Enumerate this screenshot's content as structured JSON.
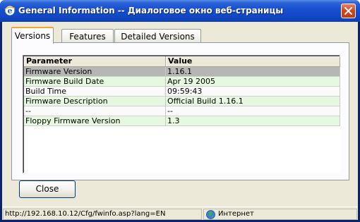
{
  "window": {
    "title": "General Information -- Диалоговое окно веб-страницы"
  },
  "tabs": [
    {
      "label": "Versions",
      "active": true
    },
    {
      "label": "Features",
      "active": false
    },
    {
      "label": "Detailed Versions",
      "active": false
    }
  ],
  "table": {
    "columns": [
      "Parameter",
      "Value"
    ],
    "rows": [
      {
        "parameter": "Firmware Version",
        "value": "1.16.1"
      },
      {
        "parameter": "Firmware Build Date",
        "value": "Apr 19 2005"
      },
      {
        "parameter": "Build Time",
        "value": "09:59:43"
      },
      {
        "parameter": "Firmware Description",
        "value": "Official Build 1.16.1"
      },
      {
        "parameter": "--",
        "value": "--"
      },
      {
        "parameter": "Floppy Firmware Version",
        "value": "1.3"
      }
    ],
    "selected_row": 0
  },
  "buttons": {
    "close_label": "Close"
  },
  "statusbar": {
    "url": "http://192.168.10.12/Cfg/fwinfo.asp?lang=EN",
    "zone": "Интернет"
  },
  "icons": {
    "title": "ie-icon",
    "close": "close-icon",
    "zone": "globe-icon"
  },
  "colors": {
    "titlebar": "#1850d0",
    "tab_highlight": "#f5a52f",
    "row_odd": "#e6f8e0",
    "row_selected": "#b6b6b6",
    "close_button": "#d5461e"
  }
}
